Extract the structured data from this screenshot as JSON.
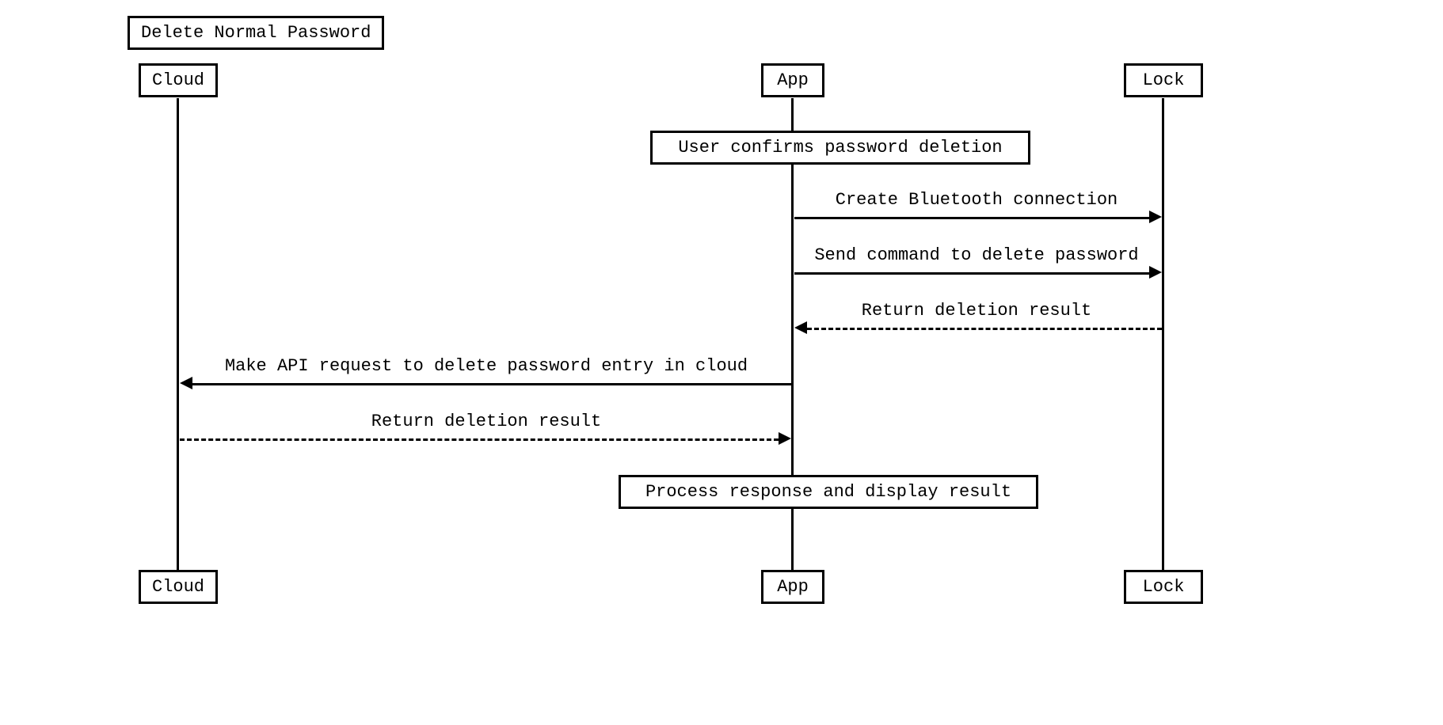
{
  "diagram": {
    "title": "Delete Normal Password",
    "participants": {
      "cloud": "Cloud",
      "app": "App",
      "lock": "Lock"
    },
    "notes": {
      "confirm": "User confirms password deletion",
      "process": "Process response and display result"
    },
    "messages": {
      "m1": "Create Bluetooth connection",
      "m2": "Send command to delete password",
      "m3": "Return deletion result",
      "m4": "Make API request to delete password entry in cloud",
      "m5": "Return deletion result"
    }
  }
}
